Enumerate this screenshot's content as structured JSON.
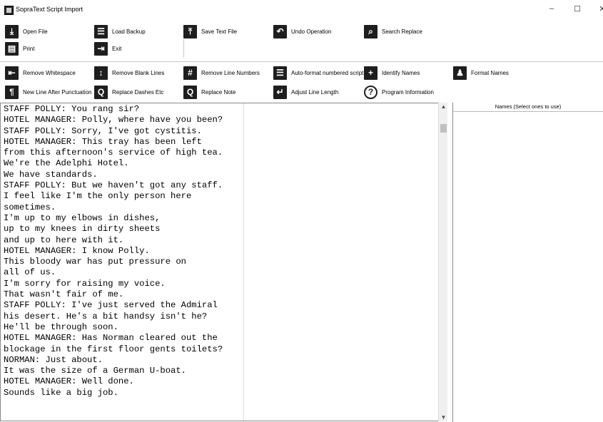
{
  "window": {
    "title": "SopraText Script Import",
    "minimize": "–",
    "maximize": "☐",
    "close": "✕"
  },
  "toolbar_row1": [
    {
      "label": "Open File",
      "icon": "download-icon",
      "glyph": "⤓"
    },
    {
      "label": "Load Backup",
      "icon": "list-icon",
      "glyph": "☰"
    },
    {
      "label": "Save Text File",
      "icon": "upload-icon",
      "glyph": "⤒"
    },
    {
      "label": "Undo Operation",
      "icon": "undo-icon",
      "glyph": "↶"
    },
    {
      "label": "Search Replace",
      "icon": "search-icon",
      "glyph": "⌕"
    },
    {
      "label": "Print",
      "icon": "printer-icon",
      "glyph": "▤"
    },
    {
      "label": "Exit",
      "icon": "exit-icon",
      "glyph": "⇥"
    }
  ],
  "toolbar_row2": [
    {
      "label": "Remove Whitespace",
      "icon": "whitespace-icon",
      "glyph": "⇤"
    },
    {
      "label": "Remove Blank Lines",
      "icon": "lines-icon",
      "glyph": "↕"
    },
    {
      "label": "Remove Line Numbers",
      "icon": "numbers-icon",
      "glyph": "#"
    },
    {
      "label": "Auto-format numbered script",
      "icon": "format-list-icon",
      "glyph": "☰"
    },
    {
      "label": "Identify Names",
      "icon": "person-add-icon",
      "glyph": "+"
    },
    {
      "label": "Format Names",
      "icon": "people-icon",
      "glyph": "♟"
    },
    {
      "label": "New Line After Punctuation",
      "icon": "paragraph-icon",
      "glyph": "¶"
    },
    {
      "label": "Replace Dashes Etc",
      "icon": "replace-icon",
      "glyph": "Q"
    },
    {
      "label": "Replace Note",
      "icon": "replace-note-icon",
      "glyph": "Q"
    },
    {
      "label": "Adjust Line Length",
      "icon": "wrap-icon",
      "glyph": "↵"
    },
    {
      "label": "Program Information",
      "icon": "help-icon",
      "glyph": "?"
    }
  ],
  "editor": {
    "lines": [
      "STAFF POLLY: You rang sir?",
      "HOTEL MANAGER: Polly, where have you been?",
      "STAFF POLLY: Sorry, I've got cystitis.",
      "HOTEL MANAGER: This tray has been left",
      "from this afternoon's service of high tea.",
      "We're the Adelphi Hotel.",
      "We have standards.",
      "STAFF POLLY: But we haven't got any staff.",
      "I feel like I'm the only person here",
      "sometimes.",
      "I'm up to my elbows in dishes,",
      "up to my knees in dirty sheets",
      "and up to here with it.",
      "HOTEL MANAGER: I know Polly.",
      "This bloody war has put pressure on",
      "all of us.",
      "I'm sorry for raising my voice.",
      "That wasn't fair of me.",
      "STAFF POLLY: I've just served the Admiral",
      "his desert. He's a bit handsy isn't he?",
      "He'll be through soon.",
      "HOTEL MANAGER: Has Norman cleared out the",
      "blockage in the first floor gents toilets?",
      "NORMAN: Just about.",
      "It was the size of a German U-boat.",
      "HOTEL MANAGER: Well done.",
      "Sounds like a big job."
    ]
  },
  "names_panel": {
    "header": "Names (Select ones to use)"
  }
}
